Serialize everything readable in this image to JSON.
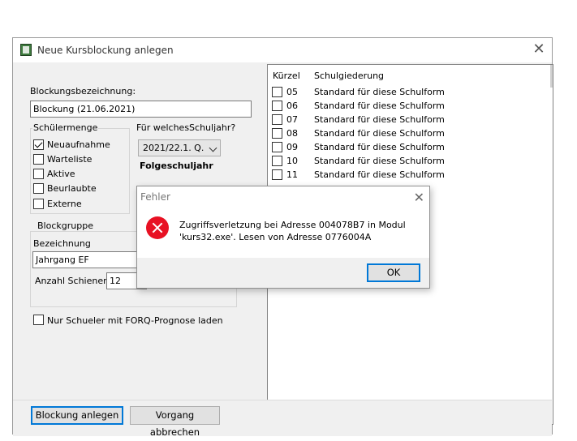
{
  "window": {
    "title": "Neue Kursblockung anlegen",
    "close_glyph": "✕"
  },
  "form": {
    "blockung_label": "Blockungsbezeichnung:",
    "blockung_value": "Blockung (21.06.2021)",
    "schuelermenge_label": "Schülermenge",
    "schuelermenge": [
      {
        "label": "Neuaufnahme",
        "checked": true
      },
      {
        "label": "Warteliste",
        "checked": false
      },
      {
        "label": "Aktive",
        "checked": false
      },
      {
        "label": "Beurlaubte",
        "checked": false
      },
      {
        "label": "Externe",
        "checked": false
      }
    ],
    "schuljahr_label": "Für welchesSchuljahr?",
    "schuljahr_value": "2021/22.1. Q.",
    "folgeschuljahr": "Folgeschuljahr",
    "blockgruppe_label": "Blockgruppe",
    "bezeichnung_label": "Bezeichnung",
    "bezeichnung_value": "Jahrgang EF",
    "schienen_label": "Anzahl Schienen",
    "schienen_value": "12",
    "forq_label": "Nur Schueler mit FORQ-Prognose laden",
    "forq_checked": false
  },
  "list": {
    "col_kuerzel": "Kürzel",
    "col_gliederung": "Schulgiederung",
    "rows": [
      {
        "kuerzel": "05",
        "text": "Standard für diese Schulform"
      },
      {
        "kuerzel": "06",
        "text": "Standard für diese Schulform"
      },
      {
        "kuerzel": "07",
        "text": "Standard für diese Schulform"
      },
      {
        "kuerzel": "08",
        "text": "Standard für diese Schulform"
      },
      {
        "kuerzel": "09",
        "text": "Standard für diese Schulform"
      },
      {
        "kuerzel": "10",
        "text": "Standard für diese Schulform"
      },
      {
        "kuerzel": "11",
        "text": "Standard für diese Schulform"
      }
    ]
  },
  "buttons": {
    "anlegen": "Blockung anlegen",
    "abbrechen": "Vorgang abbrechen"
  },
  "dialog": {
    "title": "Fehler",
    "line1": "Zugriffsverletzung bei Adresse 004078B7 in Modul",
    "line2": "'kurs32.exe'. Lesen von Adresse 0776004A",
    "ok": "OK",
    "icon": "error-icon"
  }
}
